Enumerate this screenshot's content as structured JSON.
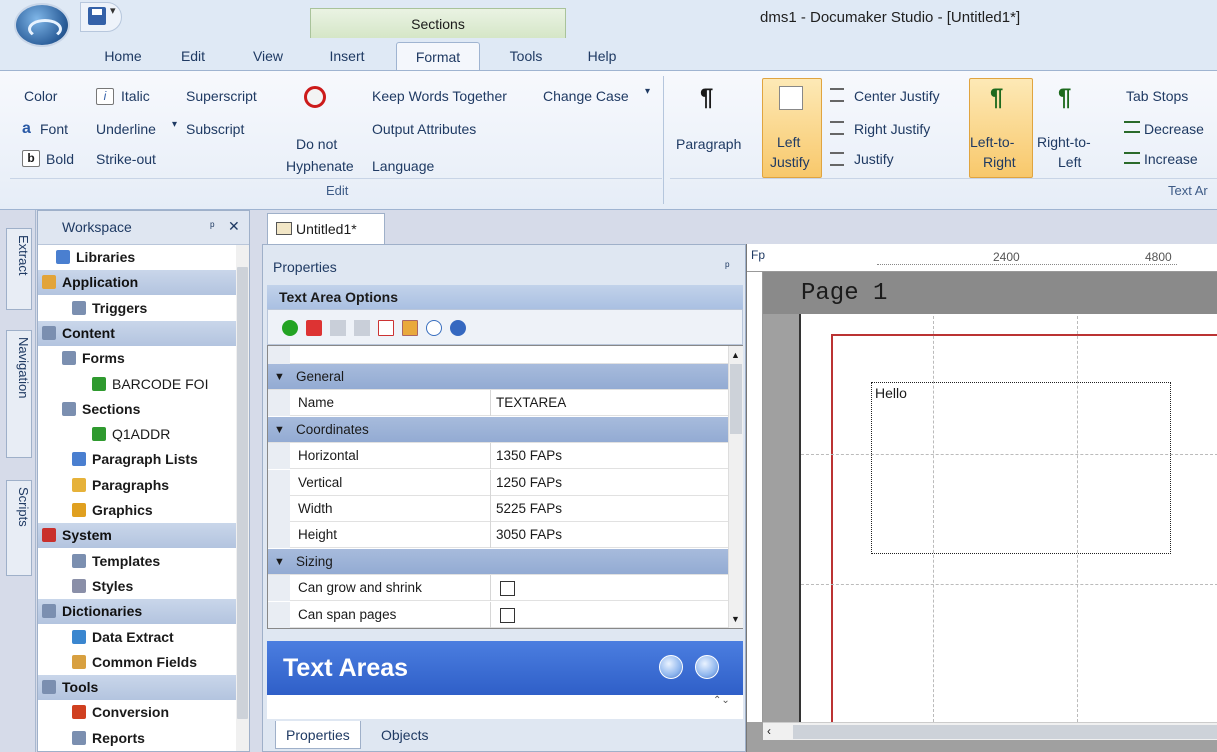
{
  "title_bar": {
    "window_title": "dms1 - Documaker Studio - [Untitled1*]",
    "context_group": "Sections",
    "qat_dropdown": "▾"
  },
  "tabs": [
    "Home",
    "Edit",
    "View",
    "Insert",
    "Format",
    "Tools",
    "Help"
  ],
  "active_tab": "Format",
  "ribbon": {
    "edit_group": {
      "label": "Edit",
      "color": "Color",
      "italic": "Italic",
      "superscript": "Superscript",
      "font": "Font",
      "underline": "Underline",
      "underline_drop": "▾",
      "subscript": "Subscript",
      "bold": "Bold",
      "strikeout": "Strike-out",
      "do_not_1": "Do not",
      "do_not_2": "Hyphenate",
      "keep_words": "Keep Words Together",
      "change_case": "Change Case",
      "change_case_drop": "▾",
      "output_attrs": "Output Attributes",
      "language": "Language"
    },
    "text_area_group": {
      "label": "Text Ar",
      "paragraph": "Paragraph",
      "left_1": "Left",
      "left_2": "Justify",
      "center": "Center Justify",
      "right": "Right Justify",
      "justify": "Justify",
      "ltr_1": "Left-to-",
      "ltr_2": "Right",
      "rtl_1": "Right-to-",
      "rtl_2": "Left",
      "tabstops": "Tab Stops",
      "decrease": "Decrease",
      "increase": "Increase"
    }
  },
  "rail_tabs": [
    "Extract",
    "Navigation",
    "Scripts"
  ],
  "workspace": {
    "title": "Workspace",
    "pin": "ᵖ",
    "close": "✕",
    "items": [
      {
        "label": "Libraries",
        "bold": true
      },
      {
        "label": "Application",
        "header": true
      },
      {
        "label": "Triggers",
        "bold": true
      },
      {
        "label": "Content",
        "header": true
      },
      {
        "label": "Forms",
        "bold": true
      },
      {
        "label": "BARCODE FOI",
        "bold": false
      },
      {
        "label": "Sections",
        "bold": true
      },
      {
        "label": "Q1ADDR",
        "bold": false
      },
      {
        "label": "Paragraph Lists",
        "bold": true
      },
      {
        "label": "Paragraphs",
        "bold": true
      },
      {
        "label": "Graphics",
        "bold": true
      },
      {
        "label": "System",
        "header": true
      },
      {
        "label": "Templates",
        "bold": true
      },
      {
        "label": "Styles",
        "bold": true
      },
      {
        "label": "Dictionaries",
        "header": true
      },
      {
        "label": "Data Extract",
        "bold": true
      },
      {
        "label": "Common Fields",
        "bold": true
      },
      {
        "label": "Tools",
        "header": true
      },
      {
        "label": "Conversion",
        "bold": true
      },
      {
        "label": "Reports",
        "bold": true
      }
    ]
  },
  "doc_tab": "Untitled1*",
  "properties": {
    "title": "Properties",
    "pin": "ᵖ",
    "section": "Text Area Options",
    "rows": [
      {
        "type": "category",
        "label": "General"
      },
      {
        "type": "prop",
        "key": "Name",
        "value": "TEXTAREA"
      },
      {
        "type": "category",
        "label": "Coordinates"
      },
      {
        "type": "prop",
        "key": "Horizontal",
        "value": "1350 FAPs"
      },
      {
        "type": "prop",
        "key": "Vertical",
        "value": "1250 FAPs"
      },
      {
        "type": "prop",
        "key": "Width",
        "value": "5225 FAPs"
      },
      {
        "type": "prop",
        "key": "Height",
        "value": "3050 FAPs"
      },
      {
        "type": "category",
        "label": "Sizing"
      },
      {
        "type": "check",
        "key": "Can grow and shrink",
        "checked": false
      },
      {
        "type": "check",
        "key": "Can span pages",
        "checked": false
      }
    ],
    "banner": "Text Areas",
    "pane_tabs": [
      "Properties",
      "Objects"
    ]
  },
  "page_view": {
    "corner": "Fp",
    "ruler_2400": "2400",
    "ruler_4800": "4800",
    "page_title": "Page 1",
    "text": "Hello"
  }
}
